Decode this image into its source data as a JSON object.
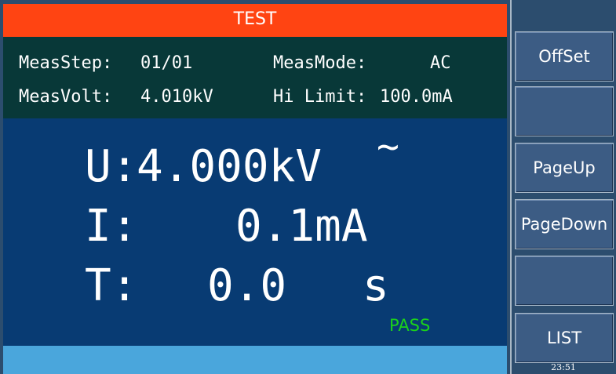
{
  "header": {
    "title": "TEST"
  },
  "info": {
    "meas_step_label": "MeasStep:",
    "meas_step_value": "01/01",
    "meas_mode_label": "MeasMode:",
    "meas_mode_value": "AC",
    "meas_volt_label": "MeasVolt:",
    "meas_volt_value": "4.010kV",
    "hi_limit_label": "Hi Limit:",
    "hi_limit_value": "100.0mA"
  },
  "readings": {
    "voltage_label": "U:",
    "voltage_value": "4.000kV",
    "voltage_unit_mark": "~",
    "current_label": "I:",
    "current_value": "0.1mA",
    "time_label": "T:",
    "time_value": "0.0",
    "time_unit": "s"
  },
  "status": {
    "result": "PASS",
    "result_color": "#1bd11b"
  },
  "softkeys": [
    {
      "label": "OffSet"
    },
    {
      "label": ""
    },
    {
      "label": "PageUp"
    },
    {
      "label": "PageDown"
    },
    {
      "label": ""
    },
    {
      "label": "LIST"
    }
  ],
  "clock": "23:51",
  "colors": {
    "title_bar": "#ff4412",
    "info_bg": "#083838",
    "meas_bg": "#083b73",
    "bottom_bar": "#4aa6dc"
  }
}
